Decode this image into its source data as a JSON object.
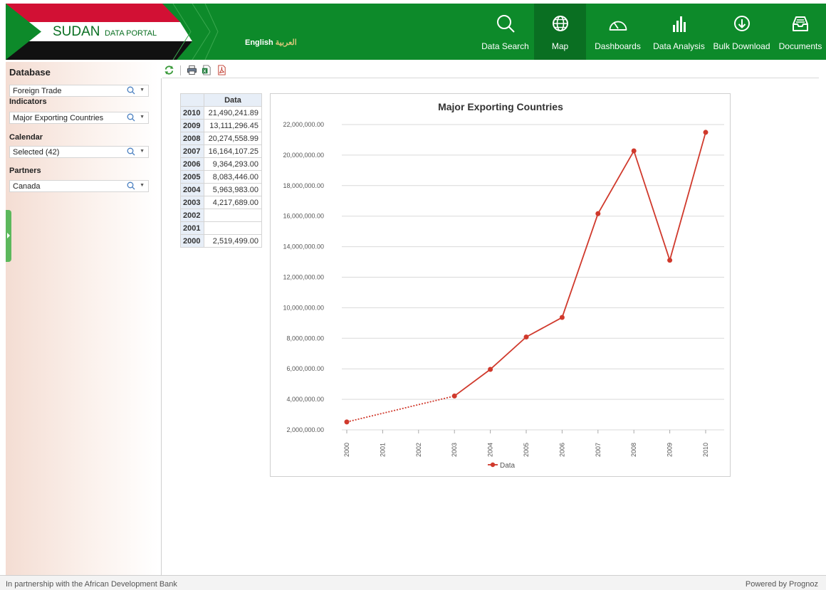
{
  "header": {
    "logo_main": "SUDAN",
    "logo_sub": "DATA PORTAL",
    "lang_english": "English",
    "lang_arabic": "العربية",
    "nav": [
      {
        "label": "Data Search",
        "icon": "search-icon"
      },
      {
        "label": "Map",
        "icon": "globe-icon",
        "active": true
      },
      {
        "label": "Dashboards",
        "icon": "gauge-icon"
      },
      {
        "label": "Data Analysis",
        "icon": "bar-chart-icon"
      },
      {
        "label": "Bulk Download",
        "icon": "download-icon"
      },
      {
        "label": "Documents",
        "icon": "inbox-icon"
      }
    ],
    "colors": {
      "header_green": "#0d8a2a",
      "active_green": "#0a6f22"
    }
  },
  "sidebar": {
    "title": "Database",
    "database_value": "Foreign Trade",
    "indicators_label": "Indicators",
    "indicators_value": "Major Exporting  Countries",
    "calendar_label": "Calendar",
    "calendar_value": "Selected (42)",
    "partners_label": "Partners",
    "partners_value": "Canada"
  },
  "toolbar": {
    "icons": [
      "refresh-icon",
      "print-icon",
      "excel-export-icon",
      "pdf-export-icon"
    ]
  },
  "table": {
    "column_header": "Data",
    "rows": [
      {
        "year": "2010",
        "value": "21,490,241.89"
      },
      {
        "year": "2009",
        "value": "13,111,296.45"
      },
      {
        "year": "2008",
        "value": "20,274,558.99"
      },
      {
        "year": "2007",
        "value": "16,164,107.25"
      },
      {
        "year": "2006",
        "value": "9,364,293.00"
      },
      {
        "year": "2005",
        "value": "8,083,446.00"
      },
      {
        "year": "2004",
        "value": "5,963,983.00"
      },
      {
        "year": "2003",
        "value": "4,217,689.00"
      },
      {
        "year": "2002",
        "value": ""
      },
      {
        "year": "2001",
        "value": ""
      },
      {
        "year": "2000",
        "value": "2,519,499.00"
      }
    ]
  },
  "chart_data": {
    "type": "line",
    "title": "Major Exporting  Countries",
    "xlabel": "",
    "ylabel": "",
    "categories": [
      "2000",
      "2001",
      "2002",
      "2003",
      "2004",
      "2005",
      "2006",
      "2007",
      "2008",
      "2009",
      "2010"
    ],
    "series": [
      {
        "name": "Data",
        "values": [
          2519499.0,
          null,
          null,
          4217689.0,
          5963983.0,
          8083446.0,
          9364293.0,
          16164107.25,
          20274558.99,
          13111296.45,
          21490241.89
        ],
        "color": "#d0392c"
      }
    ],
    "ylim": [
      2000000,
      22000000
    ],
    "yticks": [
      "2,000,000.00",
      "4,000,000.00",
      "6,000,000.00",
      "8,000,000.00",
      "10,000,000.00",
      "12,000,000.00",
      "14,000,000.00",
      "16,000,000.00",
      "18,000,000.00",
      "20,000,000.00",
      "22,000,000.00"
    ],
    "ytick_values": [
      2000000,
      4000000,
      6000000,
      8000000,
      10000000,
      12000000,
      14000000,
      16000000,
      18000000,
      20000000,
      22000000
    ],
    "gap_style": "dotted",
    "grid": true,
    "legend_position": "bottom-center"
  },
  "footer": {
    "left": "In partnership with the African Development Bank",
    "right": "Powered by Prognoz"
  }
}
